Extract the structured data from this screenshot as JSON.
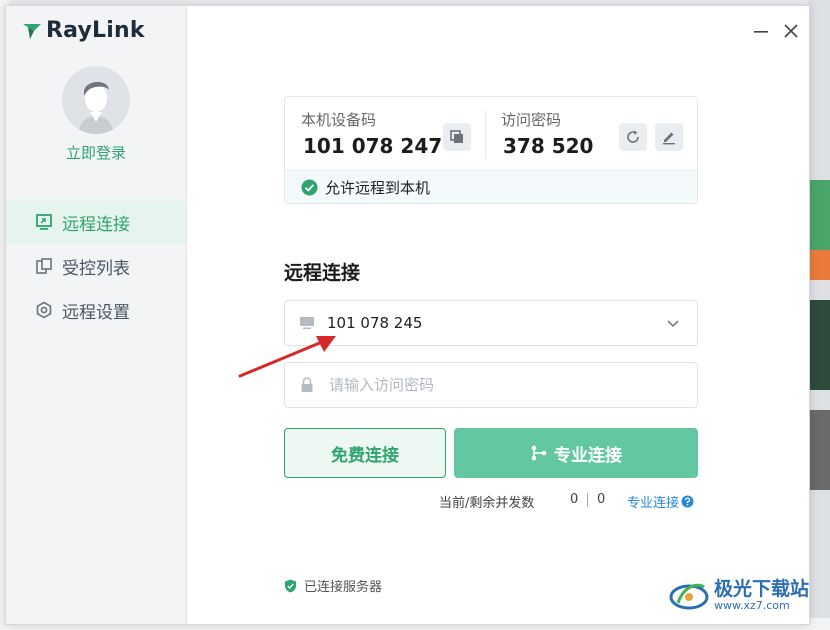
{
  "app": {
    "logo_text": "RayLink",
    "brand_color": "#2fa46f",
    "accent_color": "#63c8a1"
  },
  "sidebar": {
    "login_label": "立即登录",
    "items": [
      {
        "label": "远程连接",
        "icon": "monitor-icon",
        "active": true
      },
      {
        "label": "受控列表",
        "icon": "device-list-icon",
        "active": false
      },
      {
        "label": "远程设置",
        "icon": "hexagon-settings-icon",
        "active": false
      }
    ]
  },
  "window_controls": {
    "minimize_icon": "minimize-icon",
    "close_icon": "close-icon"
  },
  "device_card": {
    "device_code_label": "本机设备码",
    "device_code_value": "101 078 247",
    "access_password_label": "访问密码",
    "access_password_value": "378 520",
    "allow_remote_label": "允许远程到本机",
    "allow_remote_checked": true
  },
  "remote_connect": {
    "title": "远程连接",
    "device_input_value": "101 078 245",
    "password_placeholder": "请输入访问密码",
    "free_connect_label": "免费连接",
    "pro_connect_label": "专业连接",
    "concurrency_label": "当前/剩余并发数",
    "concurrency_current": "0",
    "concurrency_separator": "|",
    "concurrency_remaining": "0",
    "pro_link_label": "专业连接"
  },
  "status": {
    "server_label": "已连接服务器"
  },
  "watermark": {
    "title": "极光下载站",
    "url": "www.xz7.com"
  }
}
